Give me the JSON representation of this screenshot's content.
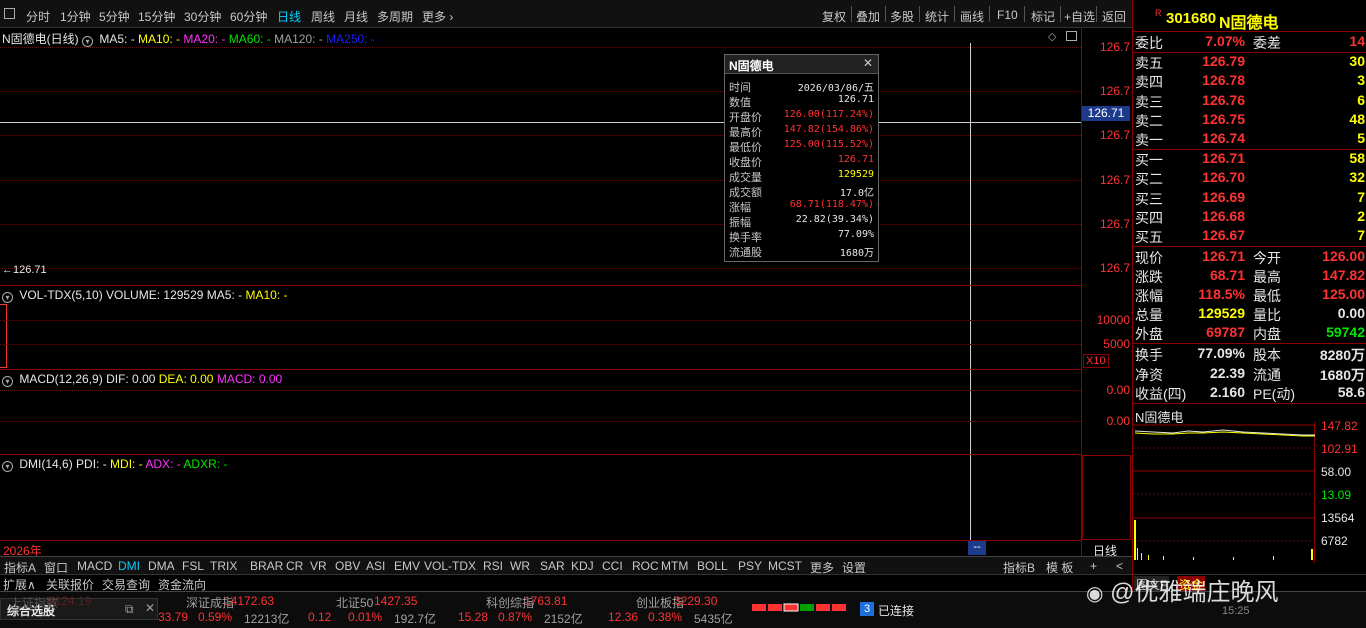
{
  "toolbar": {
    "periods": [
      "分时",
      "1分钟",
      "5分钟",
      "15分钟",
      "30分钟",
      "60分钟",
      "日线",
      "周线",
      "月线",
      "多周期",
      "更多"
    ],
    "active": "日线",
    "tools": [
      "复权",
      "叠加",
      "多股",
      "统计",
      "画线",
      "F10",
      "标记",
      "+自选",
      "返回"
    ]
  },
  "main_chart": {
    "title": "N固德电(日线)",
    "ma5": "MA5: -",
    "ma10": "MA10: -",
    "ma20": "MA20: -",
    "ma60": "MA60: -",
    "ma120": "MA120: -",
    "ma250": "MA250: -",
    "y_labels": [
      "126.7",
      "126.7",
      "126.7",
      "126.7",
      "126.7",
      "126.7",
      "126.7"
    ],
    "cursor_price": "126.71",
    "last_price_marker": "←126.71"
  },
  "tooltip": {
    "title": "N固德电",
    "rows": [
      {
        "k": "时间",
        "v": "2026/03/06/五",
        "c": "wht"
      },
      {
        "k": "数值",
        "v": "126.71",
        "c": "wht"
      },
      {
        "k": "开盘价",
        "v": "126.00(117.24%)",
        "c": "red"
      },
      {
        "k": "最高价",
        "v": "147.82(154.86%)",
        "c": "red"
      },
      {
        "k": "最低价",
        "v": "125.00(115.52%)",
        "c": "red"
      },
      {
        "k": "收盘价",
        "v": "126.71",
        "c": "red"
      },
      {
        "k": "成交量",
        "v": "129529",
        "c": "yel"
      },
      {
        "k": "成交额",
        "v": "17.0亿",
        "c": "wht"
      },
      {
        "k": "涨幅",
        "v": "68.71(118.47%)",
        "c": "red"
      },
      {
        "k": "振幅",
        "v": "22.82(39.34%)",
        "c": "wht"
      },
      {
        "k": "换手率",
        "v": "77.09%",
        "c": "wht"
      },
      {
        "k": "流通股",
        "v": "1680万",
        "c": "wht"
      }
    ]
  },
  "vol_pane": {
    "name": "VOL-TDX(5,10)",
    "volume": "VOLUME: 129529",
    "ma5": "MA5: -",
    "ma10": "MA10: -",
    "y_labels": [
      "10000",
      "5000"
    ],
    "unit": "X10"
  },
  "macd_pane": {
    "name": "MACD(12,26,9)",
    "dif": "DIF: 0.00",
    "dea": "DEA: 0.00",
    "macd": "MACD: 0.00",
    "y_labels": [
      "0.00",
      "0.00"
    ]
  },
  "dmi_pane": {
    "name": "DMI(14,6)",
    "pdi": "PDI: -",
    "mdi": "MDI: -",
    "adx": "ADX: -",
    "adxr": "ADXR: -"
  },
  "x_axis": {
    "year": "2026年",
    "cursor": "--",
    "right_label": "日线"
  },
  "indicators": [
    "指标A",
    "窗口",
    "MACD",
    "DMI",
    "DMA",
    "FSL",
    "TRIX",
    "BRAR",
    "CR",
    "VR",
    "OBV",
    "ASI",
    "EMV",
    "VOL-TDX",
    "RSI",
    "WR",
    "SAR",
    "KDJ",
    "CCI",
    "ROC",
    "MTM",
    "BOLL",
    "PSY",
    "MCST",
    "更多",
    "设置"
  ],
  "indicators_right": [
    "指标B",
    "模 板",
    "+",
    "<"
  ],
  "ext_tabs": [
    "扩展∧",
    "关联报价",
    "交易查询",
    "资金流向"
  ],
  "quote": {
    "badge": "R",
    "code": "301680",
    "name": "N固德电",
    "weibi": {
      "label": "委比",
      "value": "7.07%",
      "label2": "委差",
      "value2": "14"
    },
    "asks": [
      {
        "l": "卖五",
        "p": "126.79",
        "v": "30"
      },
      {
        "l": "卖四",
        "p": "126.78",
        "v": "3"
      },
      {
        "l": "卖三",
        "p": "126.76",
        "v": "6"
      },
      {
        "l": "卖二",
        "p": "126.75",
        "v": "48"
      },
      {
        "l": "卖一",
        "p": "126.74",
        "v": "5"
      }
    ],
    "bids": [
      {
        "l": "买一",
        "p": "126.71",
        "v": "58"
      },
      {
        "l": "买二",
        "p": "126.70",
        "v": "32"
      },
      {
        "l": "买三",
        "p": "126.69",
        "v": "7"
      },
      {
        "l": "买四",
        "p": "126.68",
        "v": "2"
      },
      {
        "l": "买五",
        "p": "126.67",
        "v": "7"
      }
    ],
    "stats": [
      {
        "l": "现价",
        "v": "126.71",
        "c": "red",
        "l2": "今开",
        "v2": "126.00",
        "c2": "red"
      },
      {
        "l": "涨跌",
        "v": "68.71",
        "c": "red",
        "l2": "最高",
        "v2": "147.82",
        "c2": "red"
      },
      {
        "l": "涨幅",
        "v": "118.5%",
        "c": "red",
        "l2": "最低",
        "v2": "125.00",
        "c2": "red"
      },
      {
        "l": "总量",
        "v": "129529",
        "c": "yel",
        "l2": "量比",
        "v2": "0.00",
        "c2": "wht"
      },
      {
        "l": "外盘",
        "v": "69787",
        "c": "red",
        "l2": "内盘",
        "v2": "59742",
        "c2": "grn"
      }
    ],
    "stats2": [
      {
        "l": "换手",
        "v": "77.09%",
        "l2": "股本",
        "v2": "8280万"
      },
      {
        "l": "净资",
        "v": "22.39",
        "l2": "流通",
        "v2": "1680万"
      },
      {
        "l": "收益(四)",
        "v": "2.160",
        "l2": "PE(动)",
        "v2": "58.6"
      }
    ],
    "mini_title": "N固德电",
    "mini_labels": [
      "147.82",
      "102.91",
      "58.00",
      "13.09",
      "13564",
      "6782"
    ]
  },
  "status": {
    "tab": "综合选股",
    "indices": [
      {
        "name": "上证指数",
        "val": "4124.19",
        "chg": "",
        "pct": "",
        "amt": ""
      },
      {
        "name": "深证成指",
        "val": "14172.63",
        "chg": "33.79",
        "pct": "0.59%",
        "amt": "12213亿"
      },
      {
        "name": "北证50",
        "val": "1427.35",
        "chg": "0.12",
        "pct": "0.01%",
        "amt": "192.7亿"
      },
      {
        "name": "科创综指",
        "val": "1763.81",
        "chg": "15.28",
        "pct": "0.87%",
        "amt": "2152亿"
      },
      {
        "name": "创业板指",
        "val": "3229.30",
        "chg": "12.36",
        "pct": "0.38%",
        "amt": "5435亿"
      }
    ],
    "conn_count": "3",
    "conn_label": "已连接",
    "time": "15:25",
    "watermark": "@优雅端庄晚风",
    "right_tabs": [
      "图文F",
      "资金"
    ]
  }
}
